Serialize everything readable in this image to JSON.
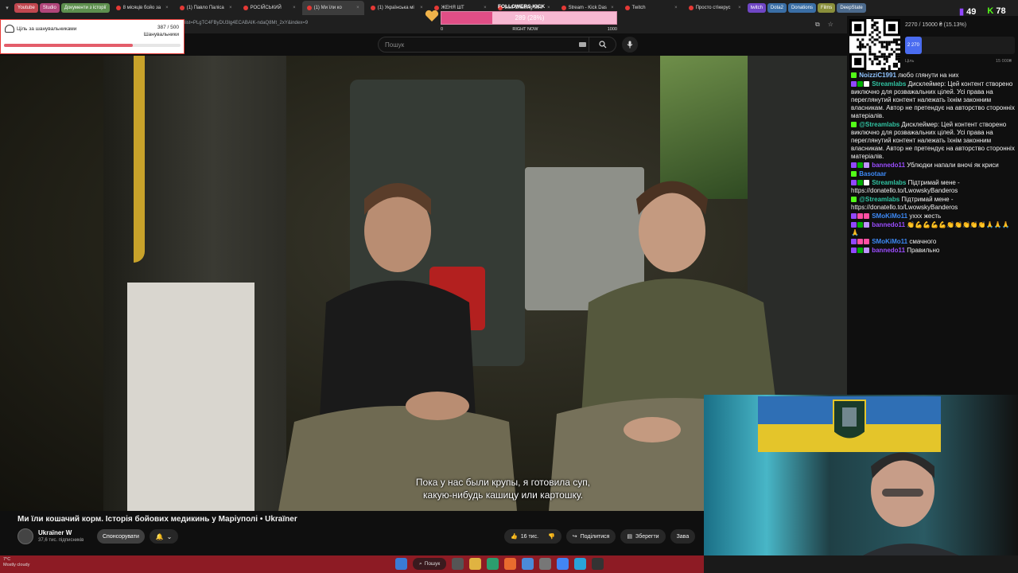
{
  "tabs": {
    "pills": [
      {
        "label": "Youtube",
        "color": "#c1474f"
      },
      {
        "label": "Studio",
        "color": "#b0457a"
      },
      {
        "label": "Документи з історії",
        "color": "#5d8f4e"
      }
    ],
    "items": [
      {
        "label": "8 місяців бойо за",
        "active": false
      },
      {
        "label": "(1) Павло Паліса",
        "active": false
      },
      {
        "label": "РОСІЙСЬКИЙ",
        "active": false
      },
      {
        "label": "(1) Ми їли ко",
        "active": true
      },
      {
        "label": "(1) Українська мі",
        "active": false
      },
      {
        "label": "ЖЕНЯ ШТ",
        "active": false
      },
      {
        "label": "Just Chatting Stre",
        "active": false
      },
      {
        "label": "Stream - Kick Das",
        "active": false
      },
      {
        "label": "Twitch",
        "active": false
      },
      {
        "label": "Просто стікерус",
        "active": false
      }
    ],
    "right_pills": [
      {
        "label": "twitch",
        "color": "#6f46c4"
      },
      {
        "label": "Dota2",
        "color": "#3a6ea5"
      },
      {
        "label": "Donations",
        "color": "#3a6ea5"
      },
      {
        "label": "Films",
        "color": "#8a8f3b"
      },
      {
        "label": "DeepState",
        "color": "#4c6a8c"
      }
    ]
  },
  "address": {
    "url": "list=PLgTC4FByDU3lg4ECABAIK-ndaQ8Mt_2xY&index=9"
  },
  "youtube": {
    "search_placeholder": "Пошук",
    "video_title": "Ми їли кошачий корм. Історія бойових медикинь у Маріуполі • Ukraїner",
    "channel": "Ukraїner W",
    "subscribers": "37,6 тис. підписників",
    "sponsor_label": "Спонсорувати",
    "like_count": "16 тис.",
    "share_label": "Поділитися",
    "save_label": "Зберегти",
    "more_label": "Зава",
    "subtitle_line1": "Пока у нас были крупы, я готовила суп,",
    "subtitle_line2": "какую-нибудь кашицу или картошку."
  },
  "goal": {
    "title": "Ціль за шанувальниками",
    "current": "387 / 500",
    "unit": "Шанувальники",
    "progress": 0.73
  },
  "followers": {
    "title": "FOLLOWERS KICK",
    "value": "289 (28%)",
    "min": "0",
    "center": "RIGHT NOW",
    "max": "1000",
    "progress": 0.289
  },
  "sub_goal": {
    "text": "2270 / 15000 ₴ (15.13%)",
    "bar_label": "2 270",
    "min_label": "Ціль",
    "max_label": "15 000₴",
    "progress": 0.1513
  },
  "corner_stats": {
    "twitch": "49",
    "kick": "78"
  },
  "chat": [
    {
      "user": "NoizziC1991",
      "color": "#8fc3ff",
      "text": "любо глянути на них",
      "badges": [
        "#53fc18"
      ]
    },
    {
      "user": "Streamlabs",
      "color": "#31c3a2",
      "text": "Дисклеймер: Цей контент створено виключно для розважальних цілей. Усі права на переглянутий контент належать їхнім законним власникам. Автор не претендує на авторство сторонніх матеріалів.",
      "badges": [
        "#9147ff",
        "#00ad03",
        "#ffffff"
      ]
    },
    {
      "user": "@Streamlabs",
      "color": "#31c3a2",
      "text": "Дисклеймер: Цей контент створено виключно для розважальних цілей. Усі права на переглянутий контент належать їхнім законним власникам. Автор не претендує на авторство сторонніх матеріалів.",
      "badges": [
        "#53fc18"
      ]
    },
    {
      "user": "bannedo11",
      "color": "#9b4dff",
      "text": "Ублюдки напали вночі як криси",
      "badges": [
        "#9147ff",
        "#00ad03",
        "#bf94ff"
      ]
    },
    {
      "user": "Basotaar",
      "color": "#3d8af7",
      "text": "",
      "badges": [
        "#53fc18"
      ]
    },
    {
      "user": "Streamlabs",
      "color": "#31c3a2",
      "text": "Підтримай мене - https://donatello.to/LwowskyBanderos",
      "badges": [
        "#9147ff",
        "#00ad03",
        "#ffffff"
      ]
    },
    {
      "user": "@Streamlabs",
      "color": "#31c3a2",
      "text": "Підтримай мене - https://donatello.to/LwowskyBanderos",
      "badges": [
        "#53fc18"
      ]
    },
    {
      "user": "SMoKiMo11",
      "color": "#3d8af7",
      "text": "уххх жесть",
      "badges": [
        "#9147ff",
        "#ff4fa3",
        "#ff4fa3"
      ]
    },
    {
      "user": "bannedo11",
      "color": "#9b4dff",
      "text": "👏💪💪💪💪👏👏👏👏👏🙏🙏🙏🙏",
      "badges": [
        "#9147ff",
        "#00ad03",
        "#bf94ff"
      ]
    },
    {
      "user": "SMoKiMo11",
      "color": "#3d8af7",
      "text": "смачного",
      "badges": [
        "#9147ff",
        "#ff4fa3",
        "#ff4fa3"
      ]
    },
    {
      "user": "bannedo11",
      "color": "#9b4dff",
      "text": "Правильно",
      "badges": [
        "#9147ff",
        "#00ad03",
        "#bf94ff"
      ]
    }
  ],
  "taskbar": {
    "temp": "7°C",
    "weather": "Mostly cloudy",
    "search_label": "Пошук"
  }
}
